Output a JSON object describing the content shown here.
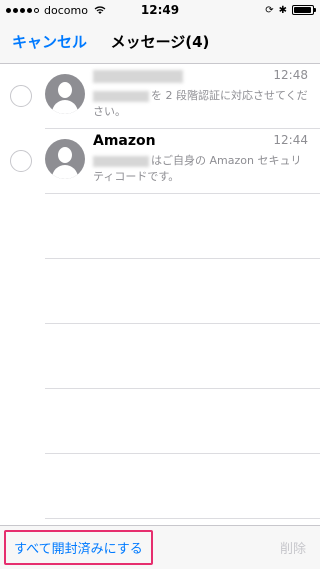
{
  "status_bar": {
    "carrier": "docomo",
    "time": "12:49",
    "signal_icon": "signal-dots-icon",
    "wifi_icon": "wifi-icon",
    "battery_icon": "battery-icon"
  },
  "nav": {
    "cancel_label": "キャンセル",
    "title": "メッセージ(4)"
  },
  "messages": [
    {
      "sender": "",
      "time": "12:48",
      "preview": "を 2 段階認証に対応させてください。"
    },
    {
      "sender": "Amazon",
      "time": "12:44",
      "preview": "はご自身の Amazon セキュリティコードです。"
    }
  ],
  "toolbar": {
    "mark_all_label": "すべて開封済みにする",
    "delete_label": "削除"
  },
  "colors": {
    "accent": "#007aff",
    "highlight": "#e62e6e"
  }
}
